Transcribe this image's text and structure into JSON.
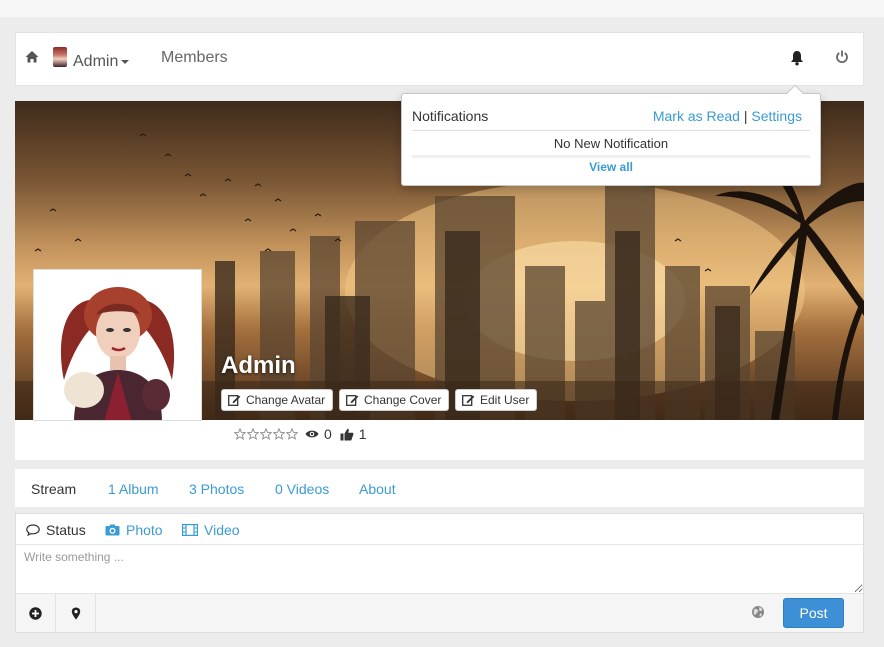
{
  "navbar": {
    "user_name": "Admin",
    "members_label": "Members",
    "icons": [
      "home-icon",
      "user-avatar",
      "bell-icon",
      "power-icon"
    ]
  },
  "notifications": {
    "title": "Notifications",
    "mark_read": "Mark as Read",
    "separator": "|",
    "settings": "Settings",
    "empty": "No New Notification",
    "view_all": "View all"
  },
  "profile": {
    "name": "Admin",
    "buttons": {
      "change_avatar": "Change Avatar",
      "change_cover": "Change Cover",
      "edit_user": "Edit User"
    },
    "rating_stars": 5,
    "views": "0",
    "likes": "1"
  },
  "tabs": [
    {
      "label": "Stream",
      "active": true
    },
    {
      "label": "1 Album"
    },
    {
      "label": "3 Photos"
    },
    {
      "label": "0 Videos"
    },
    {
      "label": "About"
    }
  ],
  "composer": {
    "tabs": {
      "status": "Status",
      "photo": "Photo",
      "video": "Video"
    },
    "placeholder": "Write something ...",
    "post_label": "Post"
  },
  "colors": {
    "link": "#3a9bd5",
    "post_button": "#3d8fd6"
  }
}
